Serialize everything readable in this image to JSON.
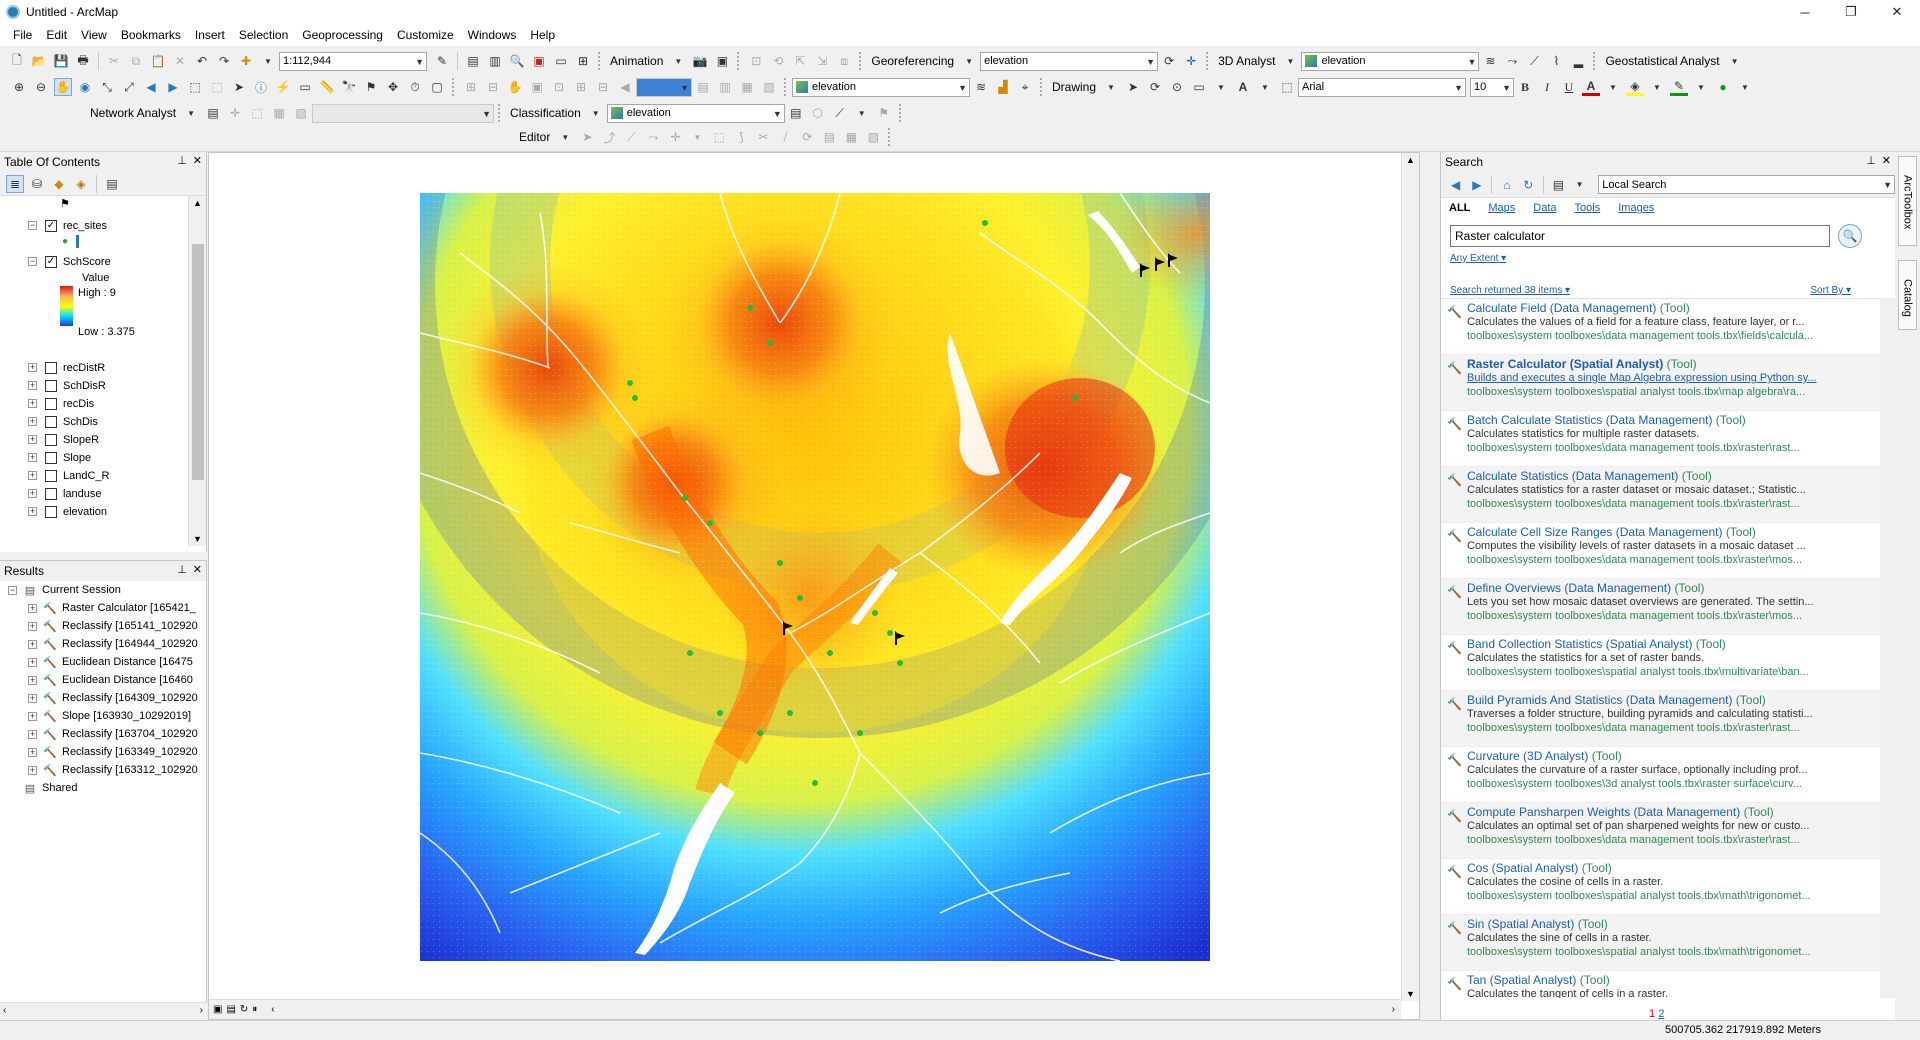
{
  "window": {
    "title": "Untitled - ArcMap",
    "controls": [
      "─",
      "❐",
      "✕"
    ]
  },
  "menubar": [
    "File",
    "Edit",
    "View",
    "Bookmarks",
    "Insert",
    "Selection",
    "Geoprocessing",
    "Customize",
    "Windows",
    "Help"
  ],
  "toolbar": {
    "scale": "1:112,944",
    "animation": "Animation",
    "georeferencing": "Georeferencing",
    "georef_layer": "elevation",
    "analyst3d": "3D Analyst",
    "analyst3d_layer": "elevation",
    "geostatistical": "Geostatistical Analyst",
    "spatial_layer": "elevation",
    "drawing": "Drawing",
    "font": "Arial",
    "font_size": "10",
    "bold": "B",
    "italic": "I",
    "underline": "U",
    "network": "Network Analyst",
    "classification": "Classification",
    "classification_layer": "elevation",
    "editor": "Editor"
  },
  "toc": {
    "title": "Table Of Contents",
    "layers": [
      {
        "name": "rec_sites",
        "checked": true,
        "expanded": true
      },
      {
        "name": "SchScore",
        "checked": true,
        "expanded": true
      },
      {
        "name": "recDistR",
        "checked": false,
        "expanded": false
      },
      {
        "name": "SchDisR",
        "checked": false,
        "expanded": false
      },
      {
        "name": "recDis",
        "checked": false,
        "expanded": false
      },
      {
        "name": "SchDis",
        "checked": false,
        "expanded": false
      },
      {
        "name": "SlopeR",
        "checked": false,
        "expanded": false
      },
      {
        "name": "Slope",
        "checked": false,
        "expanded": false
      },
      {
        "name": "LandC_R",
        "checked": false,
        "expanded": false
      },
      {
        "name": "landuse",
        "checked": false,
        "expanded": false
      },
      {
        "name": "elevation",
        "checked": false,
        "expanded": false
      }
    ],
    "legend": {
      "field": "Value",
      "high": "High : 9",
      "low": "Low : 3.375"
    }
  },
  "results": {
    "title": "Results",
    "session": "Current Session",
    "items": [
      "Raster Calculator [165421_",
      "Reclassify [165141_102920",
      "Reclassify [164944_102920",
      "Euclidean Distance [16475",
      "Euclidean Distance [16460",
      "Reclassify [164309_102920",
      "Slope [163930_10292019]",
      "Reclassify [163704_102920",
      "Reclassify [163349_102920",
      "Reclassify [163312_102920"
    ],
    "shared": "Shared"
  },
  "search": {
    "title": "Search",
    "scope": "Local Search",
    "tabs": [
      "ALL",
      "Maps",
      "Data",
      "Tools",
      "Images"
    ],
    "query": "Raster calculator",
    "extent": "Any Extent",
    "count": "Search returned 38 items",
    "sortby": "Sort By",
    "results": [
      {
        "name": "Calculate Field (Data Management)",
        "kind": "(Tool)",
        "desc": "Calculates the values of a field for a feature class, feature layer, or r...",
        "path": "toolboxes\\system toolboxes\\data management tools.tbx\\fields\\calcula..."
      },
      {
        "name": "Raster Calculator (Spatial Analyst)",
        "kind": "(Tool)",
        "desc": "Builds and executes a single Map Algebra expression using Python sy...",
        "path": "toolboxes\\system toolboxes\\spatial analyst tools.tbx\\map algebra\\ra..."
      },
      {
        "name": "Batch Calculate Statistics (Data Management)",
        "kind": "(Tool)",
        "desc": "Calculates statistics for multiple raster datasets.",
        "path": "toolboxes\\system toolboxes\\data management tools.tbx\\raster\\rast..."
      },
      {
        "name": "Calculate Statistics (Data Management)",
        "kind": "(Tool)",
        "desc": "Calculates statistics for a raster dataset or mosaic dataset.; Statistic...",
        "path": "toolboxes\\system toolboxes\\data management tools.tbx\\raster\\rast..."
      },
      {
        "name": "Calculate Cell Size Ranges (Data Management)",
        "kind": "(Tool)",
        "desc": "Computes the visibility levels of raster datasets in a mosaic dataset ...",
        "path": "toolboxes\\system toolboxes\\data management tools.tbx\\raster\\mos..."
      },
      {
        "name": "Define Overviews (Data Management)",
        "kind": "(Tool)",
        "desc": "Lets you set how mosaic dataset overviews are generated. The settin...",
        "path": "toolboxes\\system toolboxes\\data management tools.tbx\\raster\\mos..."
      },
      {
        "name": "Band Collection Statistics (Spatial Analyst)",
        "kind": "(Tool)",
        "desc": "Calculates the statistics for a set of raster bands.",
        "path": "toolboxes\\system toolboxes\\spatial analyst tools.tbx\\multivariate\\ban..."
      },
      {
        "name": "Build Pyramids And Statistics (Data Management)",
        "kind": "(Tool)",
        "desc": "Traverses a folder structure, building pyramids and calculating statisti...",
        "path": "toolboxes\\system toolboxes\\data management tools.tbx\\raster\\rast..."
      },
      {
        "name": "Curvature (3D Analyst)",
        "kind": "(Tool)",
        "desc": "Calculates the curvature of a raster surface, optionally including prof...",
        "path": "toolboxes\\system toolboxes\\3d analyst tools.tbx\\raster surface\\curv..."
      },
      {
        "name": "Compute Pansharpen Weights (Data Management)",
        "kind": "(Tool)",
        "desc": "Calculates an optimal set of pan sharpened weights for new or custo...",
        "path": "toolboxes\\system toolboxes\\data management tools.tbx\\raster\\rast..."
      },
      {
        "name": "Cos (Spatial Analyst)",
        "kind": "(Tool)",
        "desc": "Calculates the cosine of cells in a raster.",
        "path": "toolboxes\\system toolboxes\\spatial analyst tools.tbx\\math\\trigonomet..."
      },
      {
        "name": "Sin (Spatial Analyst)",
        "kind": "(Tool)",
        "desc": "Calculates the sine of cells in a raster.",
        "path": "toolboxes\\system toolboxes\\spatial analyst tools.tbx\\math\\trigonomet..."
      },
      {
        "name": "Tan (Spatial Analyst)",
        "kind": "(Tool)",
        "desc": "Calculates the tangent of cells in a raster.",
        "path": ""
      }
    ],
    "pages": [
      "1",
      "2"
    ]
  },
  "sidetabs": [
    "ArcToolbox",
    "Catalog"
  ],
  "status": {
    "coords": "500705.362  217919.892 Meters"
  }
}
